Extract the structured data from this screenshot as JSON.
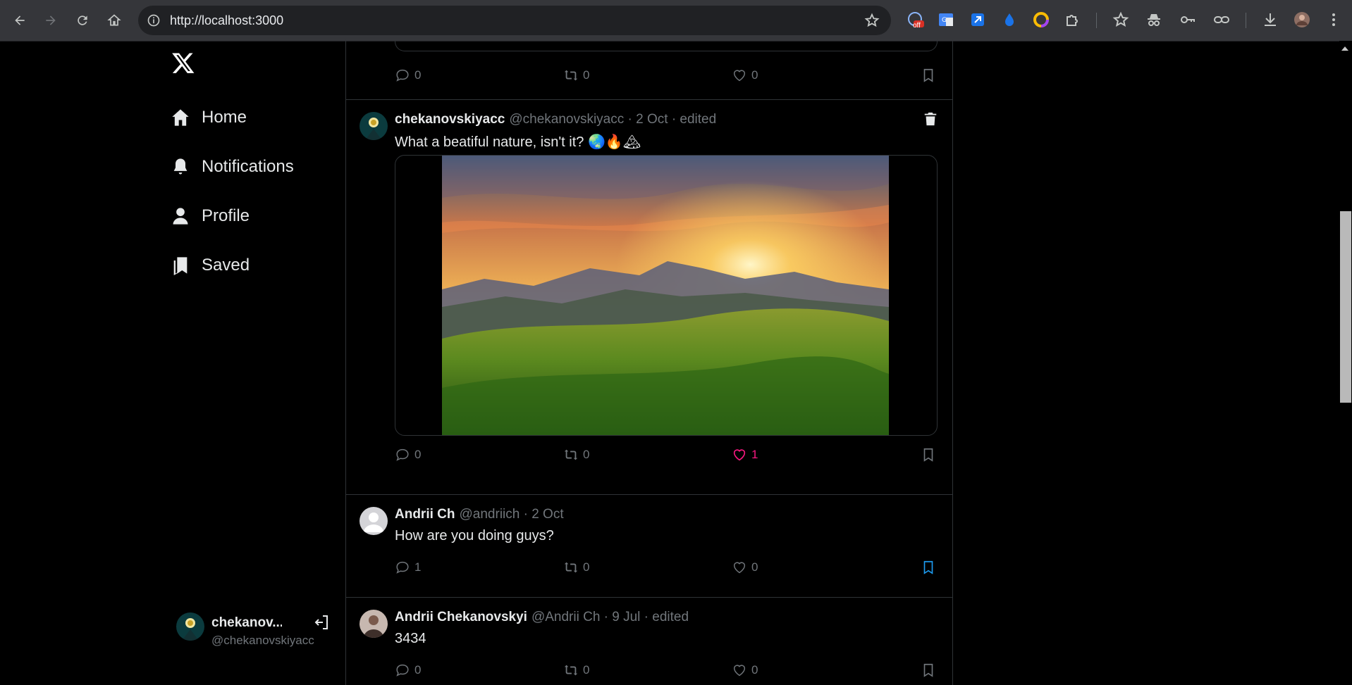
{
  "browser": {
    "url": "http://localhost:3000",
    "extension_badge": "off"
  },
  "sidebar": {
    "logo": "x-logo-icon",
    "items": [
      {
        "label": "Home",
        "icon": "home-icon"
      },
      {
        "label": "Notifications",
        "icon": "bell-icon"
      },
      {
        "label": "Profile",
        "icon": "user-icon"
      },
      {
        "label": "Saved",
        "icon": "bookmarks-icon"
      }
    ],
    "account": {
      "name": "chekanov...",
      "handle": "@chekanovskiyacc"
    }
  },
  "feed": {
    "posts": [
      {
        "id": "prev",
        "stats": {
          "comments": "0",
          "reposts": "0",
          "likes": "0"
        }
      },
      {
        "id": "nature",
        "name": "chekanovskiyacc",
        "meta": "@chekanovskiyacc · 2 Oct · edited",
        "text": "What a beatiful nature, isn't it? 🌏🔥🏔",
        "stats": {
          "comments": "0",
          "reposts": "0",
          "likes": "1"
        },
        "liked": true,
        "deletable": true
      },
      {
        "id": "doing",
        "name": "Andrii Ch",
        "meta": "@andriich · 2 Oct",
        "text": "How are you doing guys?",
        "stats": {
          "comments": "1",
          "reposts": "0",
          "likes": "0"
        },
        "saved": true
      },
      {
        "id": "num",
        "name": "Andrii Chekanovskyi",
        "meta": "@Andrii Ch · 9 Jul · edited",
        "text": "3434",
        "stats": {
          "comments": "0",
          "reposts": "0",
          "likes": "0"
        }
      }
    ]
  },
  "colors": {
    "background": "#000000",
    "border": "#2f3336",
    "muted": "#71767b",
    "like": "#f91880",
    "saved": "#1d9bf0"
  }
}
